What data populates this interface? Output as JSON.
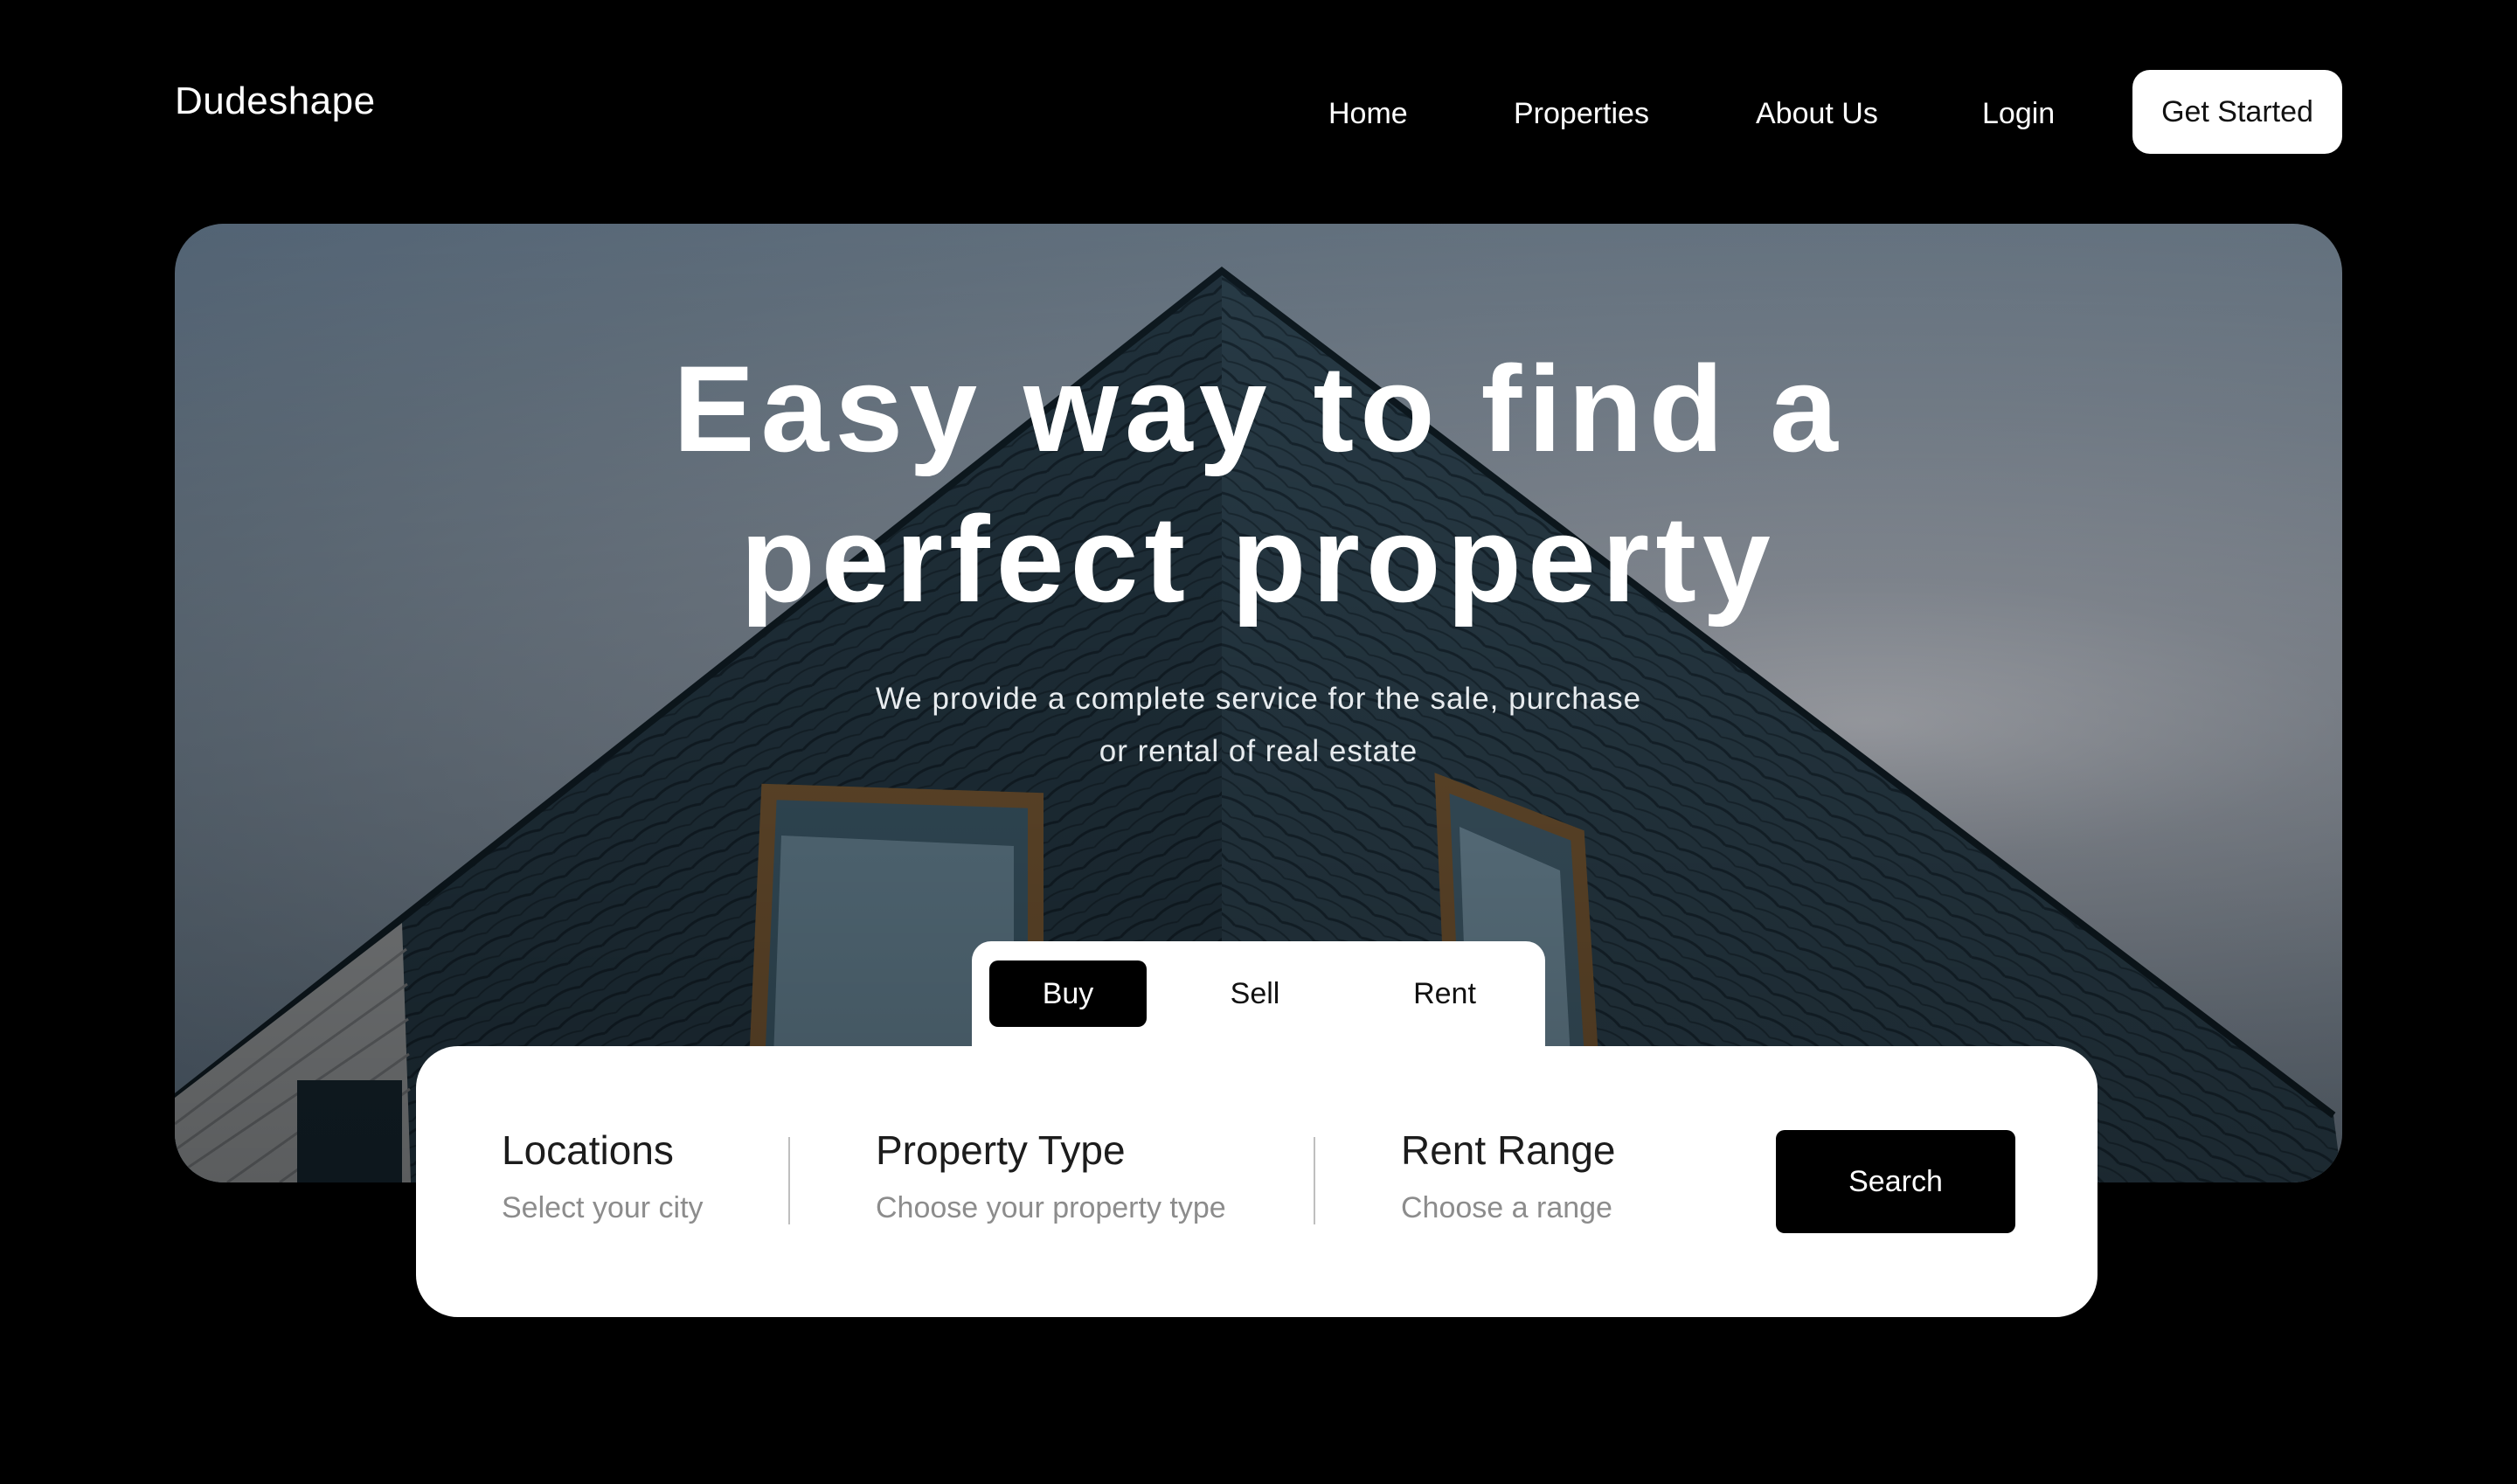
{
  "brand": {
    "name": "Dudeshape"
  },
  "nav": {
    "items": [
      {
        "label": "Home"
      },
      {
        "label": "Properties"
      },
      {
        "label": "About Us"
      },
      {
        "label": "Login"
      }
    ],
    "cta_label": "Get Started"
  },
  "hero": {
    "title_line1": "Easy way to find a",
    "title_line2": "perfect property",
    "subtitle_line1": "We provide a complete service for the sale, purchase",
    "subtitle_line2": "or rental of real estate"
  },
  "tabs": {
    "items": [
      {
        "label": "Buy",
        "active": true
      },
      {
        "label": "Sell",
        "active": false
      },
      {
        "label": "Rent",
        "active": false
      }
    ]
  },
  "search": {
    "fields": [
      {
        "label": "Locations",
        "placeholder": "Select your city"
      },
      {
        "label": "Property Type",
        "placeholder": "Choose your property type"
      },
      {
        "label": "Rent Range",
        "placeholder": "Choose a range"
      }
    ],
    "button_label": "Search"
  },
  "colors": {
    "background": "#000000",
    "panel": "#ffffff",
    "accent": "#000000",
    "sky": "#7d8894",
    "roof": "#1f323e"
  }
}
